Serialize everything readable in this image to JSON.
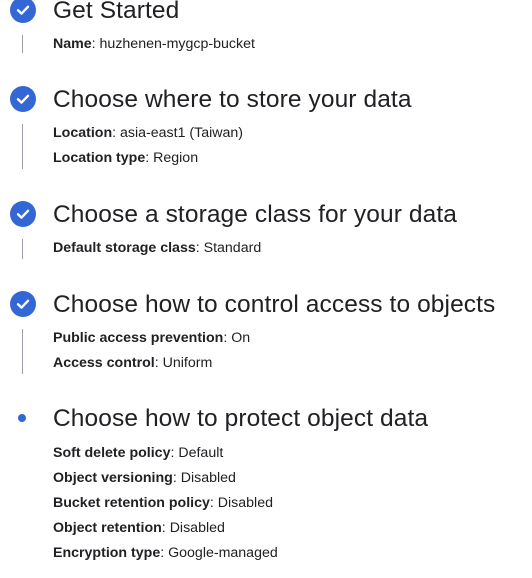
{
  "steps": [
    {
      "title": "Get Started",
      "status": "complete",
      "details": [
        {
          "label": "Name",
          "value": "huzhenen-mygcp-bucket"
        }
      ]
    },
    {
      "title": "Choose where to store your data",
      "status": "complete",
      "details": [
        {
          "label": "Location",
          "value": "asia-east1 (Taiwan)"
        },
        {
          "label": "Location type",
          "value": "Region"
        }
      ]
    },
    {
      "title": "Choose a storage class for your data",
      "status": "complete",
      "details": [
        {
          "label": "Default storage class",
          "value": "Standard"
        }
      ]
    },
    {
      "title": "Choose how to control access to objects",
      "status": "complete",
      "details": [
        {
          "label": "Public access prevention",
          "value": "On"
        },
        {
          "label": "Access control",
          "value": "Uniform"
        }
      ]
    },
    {
      "title": "Choose how to protect object data",
      "status": "current",
      "details": [
        {
          "label": "Soft delete policy",
          "value": "Default"
        },
        {
          "label": "Object versioning",
          "value": "Disabled"
        },
        {
          "label": "Bucket retention policy",
          "value": "Disabled"
        },
        {
          "label": "Object retention",
          "value": "Disabled"
        },
        {
          "label": "Encryption type",
          "value": "Google-managed"
        }
      ]
    }
  ],
  "colors": {
    "accent": "#3367d6",
    "connector": "#9aa0a6",
    "text": "#202124"
  },
  "icons": {
    "complete": "check-circle-icon",
    "current": "current-step-dot-icon"
  }
}
